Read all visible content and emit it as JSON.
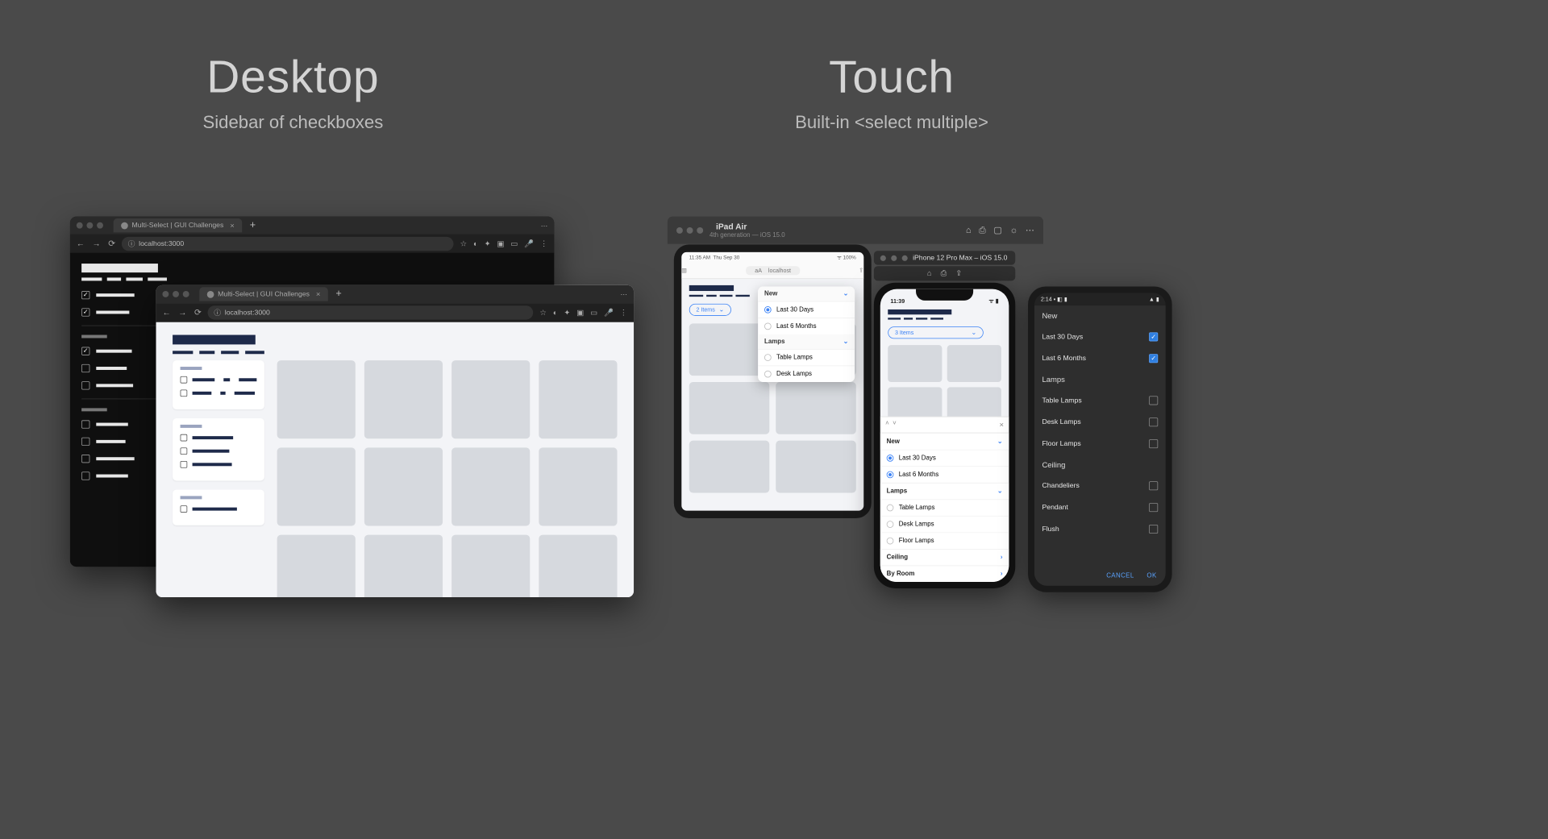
{
  "headings": {
    "desktop": {
      "title": "Desktop",
      "subtitle": "Sidebar of checkboxes"
    },
    "touch": {
      "title": "Touch",
      "subtitle": "Built-in <select multiple>"
    }
  },
  "browser": {
    "tab_title": "Multi-Select | GUI Challenges",
    "url": "localhost:3000"
  },
  "sim_ipad": {
    "name": "iPad Air",
    "detail": "4th generation — iOS 15.0",
    "status_time": "11:35 AM",
    "status_date": "Thu Sep 30",
    "url_aa": "aA",
    "url": "localhost"
  },
  "ipad_chip": "2 Items",
  "sim_iphone": "iPhone 12 Pro Max – iOS 15.0",
  "iphone_time": "11:39",
  "iphone_chip": "3 Items",
  "android_time": "2:14",
  "select_groups": {
    "new": {
      "label": "New",
      "options": [
        "Last 30 Days",
        "Last 6 Months"
      ]
    },
    "lamps": {
      "label": "Lamps",
      "options": [
        "Table Lamps",
        "Desk Lamps",
        "Floor Lamps"
      ]
    },
    "ceiling": {
      "label": "Ceiling",
      "options": [
        "Chandeliers",
        "Pendant",
        "Flush"
      ]
    },
    "byroom": {
      "label": "By Room"
    }
  },
  "android_actions": {
    "cancel": "CANCEL",
    "ok": "OK"
  }
}
